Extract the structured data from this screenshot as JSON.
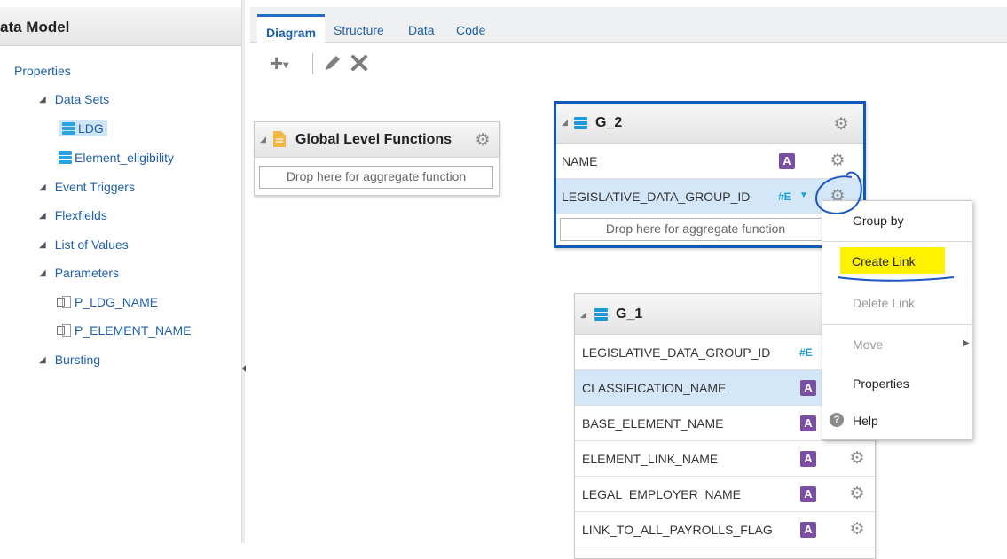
{
  "sidebar": {
    "title": "ata Model",
    "items": [
      {
        "label": "Properties"
      },
      {
        "label": "Data Sets"
      },
      {
        "label": "LDG"
      },
      {
        "label": "Element_eligibility"
      },
      {
        "label": "Event Triggers"
      },
      {
        "label": "Flexfields"
      },
      {
        "label": "List of Values"
      },
      {
        "label": "Parameters"
      },
      {
        "label": "P_LDG_NAME"
      },
      {
        "label": "P_ELEMENT_NAME"
      },
      {
        "label": "Bursting"
      }
    ]
  },
  "tabs": [
    {
      "label": "Diagram",
      "active": true
    },
    {
      "label": "Structure"
    },
    {
      "label": "Data"
    },
    {
      "label": "Code"
    }
  ],
  "toolbar": {
    "add": "+",
    "add_caret": "▾",
    "edit_icon": "pencil-icon",
    "delete_icon": "close-icon"
  },
  "global_functions": {
    "title": "Global Level Functions",
    "drop_text": "Drop here for aggregate function"
  },
  "g2": {
    "title": "G_2",
    "rows": [
      {
        "name": "NAME",
        "type": "A"
      },
      {
        "name": "LEGISLATIVE_DATA_GROUP_ID",
        "type": "#E"
      }
    ],
    "drop_text": "Drop here for aggregate function"
  },
  "g1": {
    "title": "G_1",
    "rows": [
      {
        "name": "LEGISLATIVE_DATA_GROUP_ID",
        "type": "#E"
      },
      {
        "name": "CLASSIFICATION_NAME",
        "type": "A"
      },
      {
        "name": "BASE_ELEMENT_NAME",
        "type": "A"
      },
      {
        "name": "ELEMENT_LINK_NAME",
        "type": "A"
      },
      {
        "name": "LEGAL_EMPLOYER_NAME",
        "type": "A"
      },
      {
        "name": "LINK_TO_ALL_PAYROLLS_FLAG",
        "type": "A"
      }
    ]
  },
  "context_menu": {
    "items": [
      {
        "label": "Group by"
      },
      {
        "label": "Create Link",
        "highlighted": true
      },
      {
        "label": "Delete Link",
        "disabled": true
      },
      {
        "label": "Move",
        "disabled": true
      },
      {
        "label": "Properties"
      },
      {
        "label": "Help"
      }
    ]
  },
  "colors": {
    "accent": "#1f5fa8",
    "selection": "#d4e7f8",
    "highlight": "#fff200",
    "annotation": "#1a56c4",
    "attr_badge": "#7a4ea3",
    "num_badge": "#1aa0d8"
  }
}
